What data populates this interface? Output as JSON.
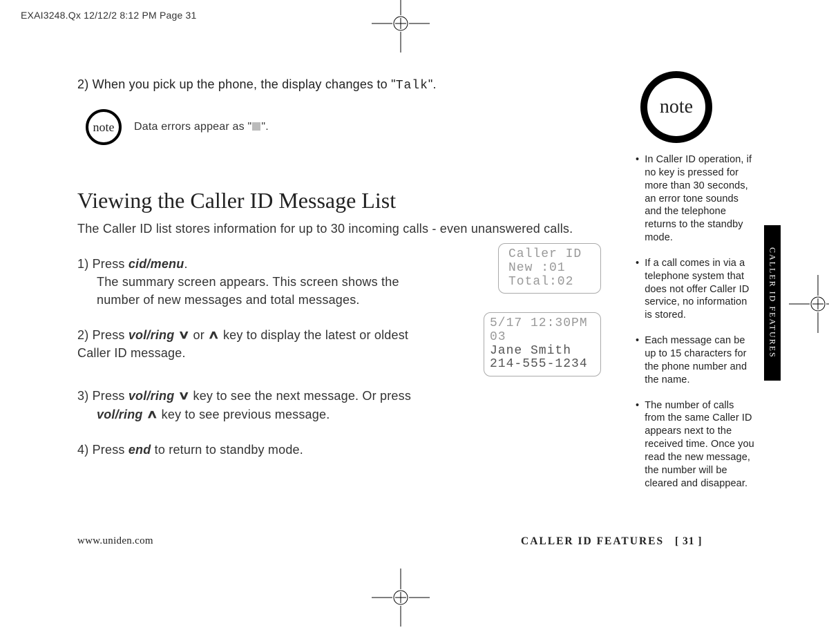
{
  "printheader": "EXAI3248.Qx  12/12/2  8:12 PM  Page 31",
  "note_label": "note",
  "step2_lead": "2) When you pick up the phone, the display changes to \"",
  "step2_mono": "Talk",
  "step2_end": "\".",
  "data_errors_prefix": "Data errors appear as \"",
  "data_errors_suffix": "\".",
  "heading": "Viewing the Caller ID Message List",
  "intro": "The Caller ID list stores information for up to 30 incoming calls - even unanswered calls.",
  "steps": {
    "s1_a": "1) Press ",
    "s1_key": "cid/menu",
    "s1_b": ".",
    "s1_line2": "The summary screen appears. This screen shows the number of new messages and total messages.",
    "s2_a": "2) Press ",
    "s2_key": "vol/ring",
    "s2_mid": " or ",
    "s2_b": " key to display the latest or oldest Caller ID message.",
    "s3_a": "3) Press ",
    "s3_keyA": "vol/ring",
    "s3_mid": " key to see the next message. Or press ",
    "s3_keyB": "vol/ring",
    "s3_b": " key to see previous message.",
    "s4_a": "4) Press ",
    "s4_key": "end",
    "s4_b": " to return to standby mode."
  },
  "lcd1": {
    "l1": " Caller ID",
    "l2": " New  :01",
    "l3": " Total:02"
  },
  "lcd2": {
    "l1": " 5/17 12:30PM 03",
    "l2": "Jane Smith",
    "l3": "214-555-1234"
  },
  "notes": [
    "In Caller ID operation, if no key is pressed for more than 30 seconds, an error tone sounds and the telephone returns to the standby mode.",
    "If a call comes in via a telephone system that does not offer Caller ID service, no information is stored.",
    "Each message can be up to 15 characters for the phone number and the name.",
    "The number of calls from the same Caller ID appears next to the received time. Once you read the new message, the number will be cleared and disappear."
  ],
  "side_tab": "CALLER ID FEATURES",
  "footer_left": "www.uniden.com",
  "footer_section": "CALLER ID FEATURES",
  "footer_page": "[ 31 ]"
}
